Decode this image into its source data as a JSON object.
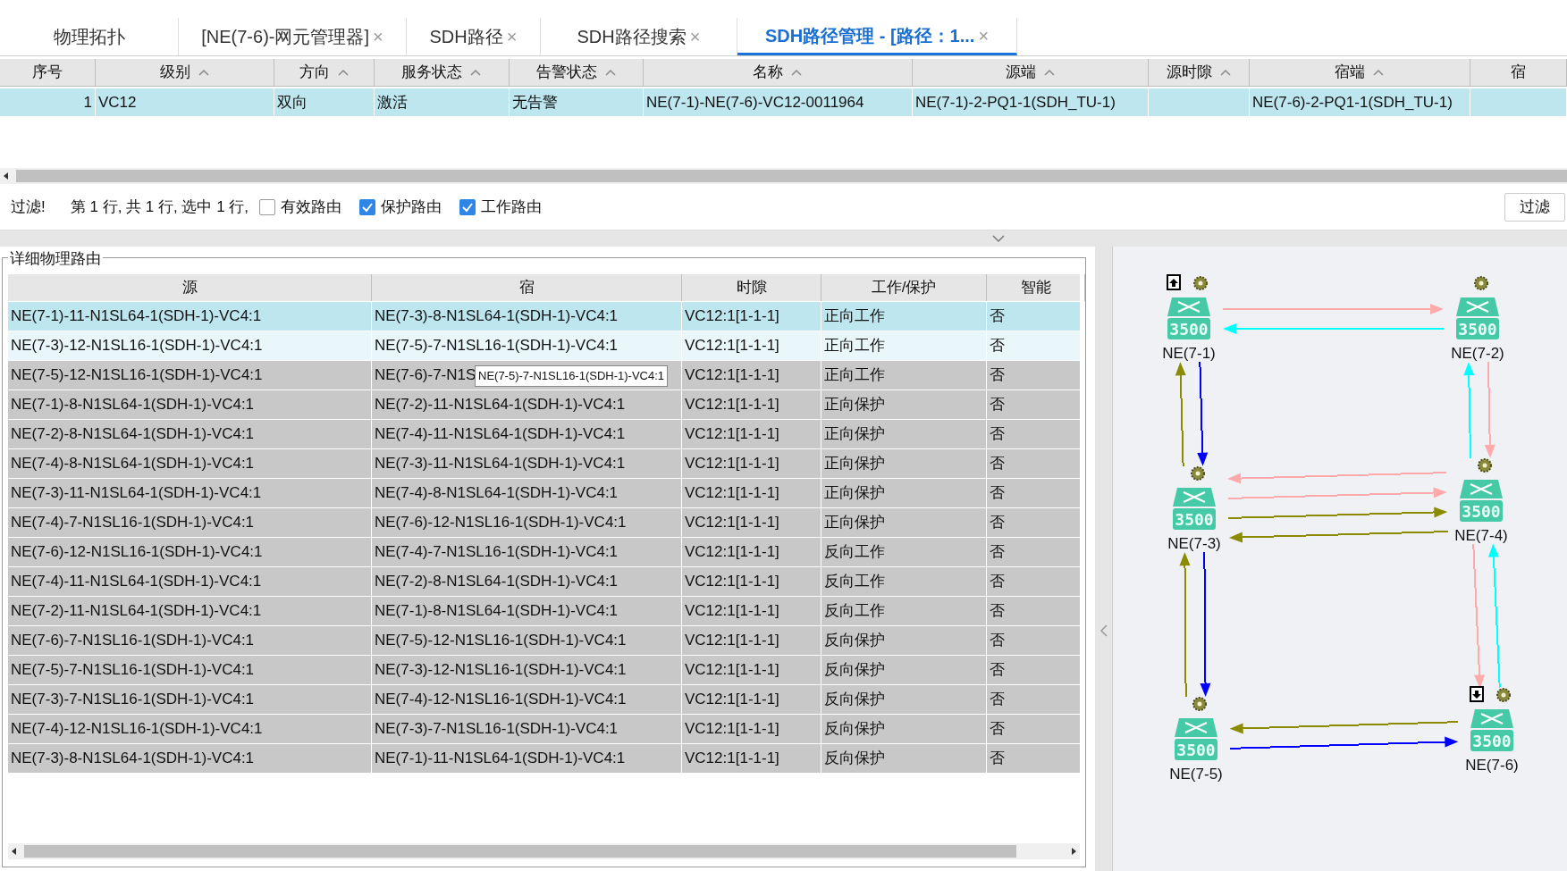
{
  "tabs": [
    {
      "label": "物理拓扑",
      "selected": false
    },
    {
      "label": "[NE(7-6)-网元管理器]",
      "close": "×",
      "selected": false
    },
    {
      "label": "SDH路径",
      "close": "×",
      "selected": false
    },
    {
      "label": "SDH路径搜索",
      "close": "×",
      "selected": false
    },
    {
      "label": "SDH路径管理 - [路径：1...",
      "close": "×",
      "selected": true
    }
  ],
  "path_table": {
    "columns": [
      {
        "label": "序号",
        "sortable": false
      },
      {
        "label": "级别",
        "sortable": true
      },
      {
        "label": "方向",
        "sortable": true
      },
      {
        "label": "服务状态",
        "sortable": true
      },
      {
        "label": "告警状态",
        "sortable": true
      },
      {
        "label": "名称",
        "sortable": true
      },
      {
        "label": "源端",
        "sortable": true
      },
      {
        "label": "源时隙",
        "sortable": true
      },
      {
        "label": "宿端",
        "sortable": true
      },
      {
        "label": "宿",
        "sortable": false
      }
    ],
    "rows": [
      {
        "selected": true,
        "index": "1",
        "level": "VC12",
        "direction": "双向",
        "service_state": "激活",
        "alarm_state": "无告警",
        "name": "NE(7-1)-NE(7-6)-VC12-0011964",
        "source": "NE(7-1)-2-PQ1-1(SDH_TU-1)",
        "sink": "NE(7-6)-2-PQ1-1(SDH_TU-1)"
      }
    ]
  },
  "filter_bar": {
    "status": "过滤!",
    "summary": "第 1 行, 共 1 行, 选中 1 行,",
    "checkboxes": [
      {
        "label": "有效路由",
        "checked": false
      },
      {
        "label": "保护路由",
        "checked": true
      },
      {
        "label": "工作路由",
        "checked": true
      }
    ],
    "filter_button": "过滤"
  },
  "route_panel": {
    "title": "详细物理路由",
    "columns": [
      "源",
      "宿",
      "时隙",
      "工作/保护",
      "智能"
    ],
    "rows": [
      {
        "selected": true,
        "highlighted": false,
        "cells": [
          "NE(7-1)-11-N1SL64-1(SDH-1)-VC4:1",
          "NE(7-3)-8-N1SL64-1(SDH-1)-VC4:1",
          "VC12:1[1-1-1]",
          "正向工作",
          "否"
        ]
      },
      {
        "selected": false,
        "highlighted": false,
        "cells": [
          "NE(7-3)-12-N1SL16-1(SDH-1)-VC4:1",
          "NE(7-5)-7-N1SL16-1(SDH-1)-VC4:1",
          "VC12:1[1-1-1]",
          "正向工作",
          "否"
        ]
      },
      {
        "selected": false,
        "highlighted": true,
        "cells": [
          "NE(7-5)-12-N1SL16-1(SDH-1)-VC4:1",
          "NE(7-6)-7-N1S",
          "VC12:1[1-1-1]",
          "正向工作",
          "否"
        ]
      },
      {
        "selected": false,
        "highlighted": true,
        "cells": [
          "NE(7-1)-8-N1SL64-1(SDH-1)-VC4:1",
          "NE(7-2)-11-N1SL64-1(SDH-1)-VC4:1",
          "VC12:1[1-1-1]",
          "正向保护",
          "否"
        ]
      },
      {
        "selected": false,
        "highlighted": true,
        "cells": [
          "NE(7-2)-8-N1SL64-1(SDH-1)-VC4:1",
          "NE(7-4)-11-N1SL64-1(SDH-1)-VC4:1",
          "VC12:1[1-1-1]",
          "正向保护",
          "否"
        ]
      },
      {
        "selected": false,
        "highlighted": true,
        "cells": [
          "NE(7-4)-8-N1SL64-1(SDH-1)-VC4:1",
          "NE(7-3)-11-N1SL64-1(SDH-1)-VC4:1",
          "VC12:1[1-1-1]",
          "正向保护",
          "否"
        ]
      },
      {
        "selected": false,
        "highlighted": true,
        "cells": [
          "NE(7-3)-11-N1SL64-1(SDH-1)-VC4:1",
          "NE(7-4)-8-N1SL64-1(SDH-1)-VC4:1",
          "VC12:1[1-1-1]",
          "正向保护",
          "否"
        ]
      },
      {
        "selected": false,
        "highlighted": true,
        "cells": [
          "NE(7-4)-7-N1SL16-1(SDH-1)-VC4:1",
          "NE(7-6)-12-N1SL16-1(SDH-1)-VC4:1",
          "VC12:1[1-1-1]",
          "正向保护",
          "否"
        ]
      },
      {
        "selected": false,
        "highlighted": true,
        "cells": [
          "NE(7-6)-12-N1SL16-1(SDH-1)-VC4:1",
          "NE(7-4)-7-N1SL16-1(SDH-1)-VC4:1",
          "VC12:1[1-1-1]",
          "反向工作",
          "否"
        ]
      },
      {
        "selected": false,
        "highlighted": true,
        "cells": [
          "NE(7-4)-11-N1SL64-1(SDH-1)-VC4:1",
          "NE(7-2)-8-N1SL64-1(SDH-1)-VC4:1",
          "VC12:1[1-1-1]",
          "反向工作",
          "否"
        ]
      },
      {
        "selected": false,
        "highlighted": true,
        "cells": [
          "NE(7-2)-11-N1SL64-1(SDH-1)-VC4:1",
          "NE(7-1)-8-N1SL64-1(SDH-1)-VC4:1",
          "VC12:1[1-1-1]",
          "反向工作",
          "否"
        ]
      },
      {
        "selected": false,
        "highlighted": true,
        "cells": [
          "NE(7-6)-7-N1SL16-1(SDH-1)-VC4:1",
          "NE(7-5)-12-N1SL16-1(SDH-1)-VC4:1",
          "VC12:1[1-1-1]",
          "反向保护",
          "否"
        ]
      },
      {
        "selected": false,
        "highlighted": true,
        "cells": [
          "NE(7-5)-7-N1SL16-1(SDH-1)-VC4:1",
          "NE(7-3)-12-N1SL16-1(SDH-1)-VC4:1",
          "VC12:1[1-1-1]",
          "反向保护",
          "否"
        ]
      },
      {
        "selected": false,
        "highlighted": true,
        "cells": [
          "NE(7-3)-7-N1SL16-1(SDH-1)-VC4:1",
          "NE(7-4)-12-N1SL16-1(SDH-1)-VC4:1",
          "VC12:1[1-1-1]",
          "反向保护",
          "否"
        ]
      },
      {
        "selected": false,
        "highlighted": true,
        "cells": [
          "NE(7-4)-12-N1SL16-1(SDH-1)-VC4:1",
          "NE(7-3)-7-N1SL16-1(SDH-1)-VC4:1",
          "VC12:1[1-1-1]",
          "反向保护",
          "否"
        ]
      },
      {
        "selected": false,
        "highlighted": true,
        "cells": [
          "NE(7-3)-8-N1SL64-1(SDH-1)-VC4:1",
          "NE(7-1)-11-N1SL64-1(SDH-1)-VC4:1",
          "VC12:1[1-1-1]",
          "反向保护",
          "否"
        ]
      }
    ],
    "tooltip": "NE(7-5)-7-N1SL16-1(SDH-1)-VC4:1"
  },
  "topology": {
    "nodes": [
      {
        "label": "NE(7-1)",
        "model": "3500",
        "upload_marker": true
      },
      {
        "label": "NE(7-2)",
        "model": "3500"
      },
      {
        "label": "NE(7-3)",
        "model": "3500"
      },
      {
        "label": "NE(7-4)",
        "model": "3500"
      },
      {
        "label": "NE(7-5)",
        "model": "3500"
      },
      {
        "label": "NE(7-6)",
        "model": "3500",
        "download_marker": true
      }
    ],
    "connections": [
      {
        "arrows": [
          {
            "kind": "forward",
            "color": "#ffaaaa"
          },
          {
            "kind": "backward",
            "color": "#00ffff"
          }
        ]
      },
      {
        "arrows": [
          {
            "kind": "forward",
            "color": "#0000ff"
          },
          {
            "kind": "backward",
            "color": "#8b8b00"
          }
        ]
      },
      {
        "arrows": [
          {
            "kind": "forward",
            "color": "#ffaaaa"
          },
          {
            "kind": "backward",
            "color": "#00ffff"
          }
        ]
      },
      {
        "arrows": [
          {
            "kind": "backward",
            "color": "#ffaaaa"
          },
          {
            "kind": "forward",
            "color": "#ffaaaa"
          },
          {
            "kind": "forward",
            "color": "#8b8b00"
          },
          {
            "kind": "backward",
            "color": "#8b8b00"
          }
        ]
      },
      {
        "arrows": [
          {
            "kind": "forward",
            "color": "#0000ff"
          },
          {
            "kind": "backward",
            "color": "#8b8b00"
          }
        ]
      },
      {
        "arrows": [
          {
            "kind": "backward",
            "color": "#00ffff"
          },
          {
            "kind": "forward",
            "color": "#ffaaaa"
          }
        ]
      },
      {
        "arrows": [
          {
            "kind": "backward",
            "color": "#8b8b00"
          },
          {
            "kind": "forward",
            "color": "#0000ff"
          }
        ]
      }
    ]
  }
}
